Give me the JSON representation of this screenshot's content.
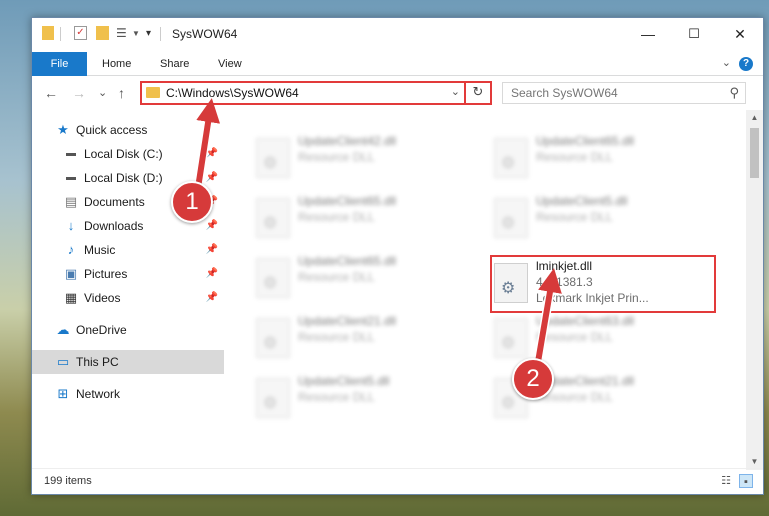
{
  "window": {
    "title": "SysWOW64",
    "controls": {
      "minimize": "—",
      "maximize": "☐",
      "close": "✕"
    }
  },
  "ribbon": {
    "tabs": [
      "File",
      "Home",
      "Share",
      "View"
    ],
    "help": "?",
    "expand": "⌄"
  },
  "navigation": {
    "back": "←",
    "forward": "→",
    "recent": "⌄",
    "up": "↑"
  },
  "address": {
    "path": "C:\\Windows\\SysWOW64",
    "dropdown": "⌄",
    "refresh": "↻"
  },
  "search": {
    "placeholder": "Search SysWOW64",
    "icon": "search-icon"
  },
  "sidebar": {
    "items": [
      {
        "label": "Quick access",
        "icon": "star-icon",
        "pinned": false
      },
      {
        "label": "Local Disk (C:)",
        "icon": "drive-icon",
        "pinned": true
      },
      {
        "label": "Local Disk (D:)",
        "icon": "drive-icon",
        "pinned": true
      },
      {
        "label": "Documents",
        "icon": "documents-icon",
        "pinned": true
      },
      {
        "label": "Downloads",
        "icon": "download-icon",
        "pinned": true
      },
      {
        "label": "Music",
        "icon": "music-icon",
        "pinned": true
      },
      {
        "label": "Pictures",
        "icon": "pictures-icon",
        "pinned": true
      },
      {
        "label": "Videos",
        "icon": "videos-icon",
        "pinned": true
      },
      {
        "label": "OneDrive",
        "icon": "cloud-icon",
        "pinned": false
      },
      {
        "label": "This PC",
        "icon": "computer-icon",
        "pinned": false,
        "selected": true
      },
      {
        "label": "Network",
        "icon": "network-icon",
        "pinned": false
      }
    ]
  },
  "files": [
    {
      "name": "UpdateClient42.dll",
      "desc": "Resource DLL",
      "blurred": true
    },
    {
      "name": "UpdateClient65.dll",
      "desc": "Resource DLL",
      "blurred": true
    },
    {
      "name": "UpdateClient65.dll",
      "desc": "Resource DLL",
      "blurred": true
    },
    {
      "name": "UpdateClient5.dll",
      "desc": "Resource DLL",
      "blurred": true
    },
    {
      "name": "UpdateClient65.dll",
      "desc": "Resource DLL",
      "blurred": true
    },
    {
      "name": "lminkjet.dll",
      "desc": "4.0.1381.3",
      "desc2": "Lexmark Inkjet Prin...",
      "blurred": false,
      "highlighted": true
    },
    {
      "name": "UpdateClient21.dll",
      "desc": "Resource DLL",
      "blurred": true
    },
    {
      "name": "UpdateClient63.dll",
      "desc": "Resource DLL",
      "blurred": true
    },
    {
      "name": "UpdateClient5.dll",
      "desc": "Resource DLL",
      "blurred": true
    },
    {
      "name": "UpdateClient21.dll",
      "desc": "Resource DLL",
      "blurred": true
    }
  ],
  "status": {
    "item_count": "199 items"
  },
  "annotations": [
    {
      "label": "1"
    },
    {
      "label": "2"
    }
  ],
  "colors": {
    "accent": "#1979ca",
    "highlight": "#e23a3a",
    "badge": "#d63a3a",
    "selection": "#d9d9d9"
  }
}
